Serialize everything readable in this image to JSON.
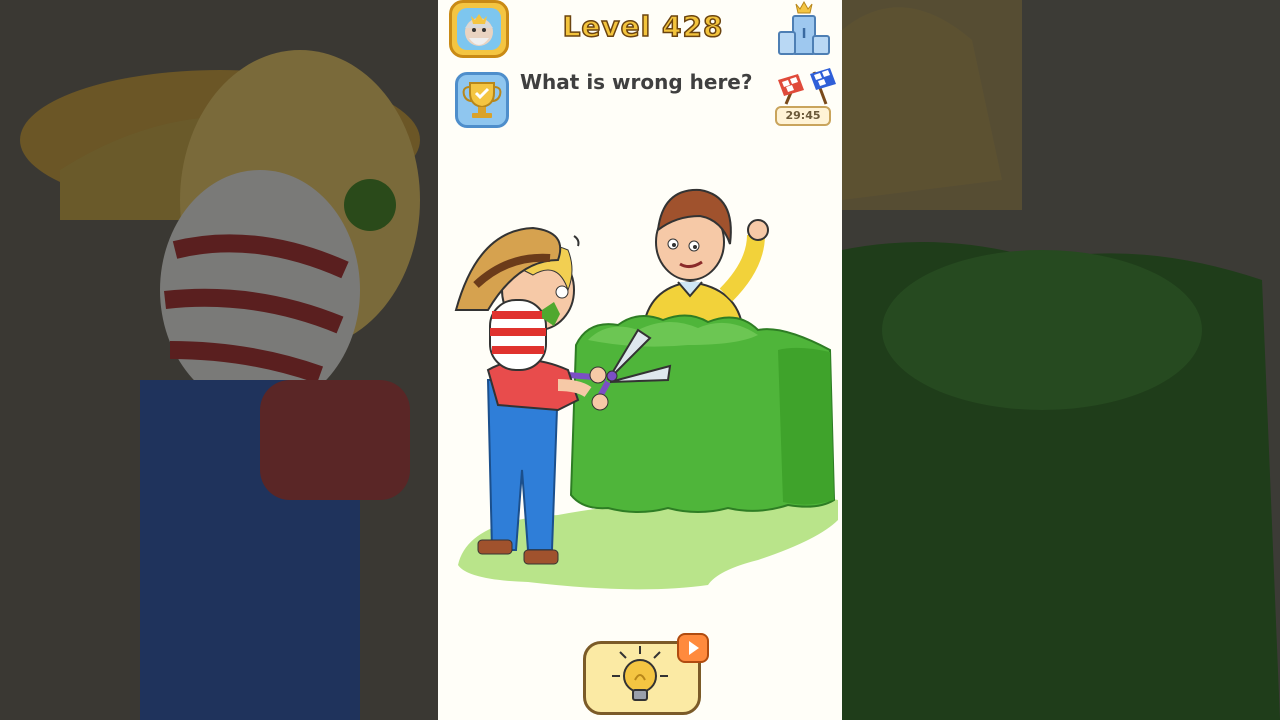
{
  "hud": {
    "level_title": "Level 428",
    "question": "What is wrong here?",
    "timer": "29:45"
  },
  "icons": {
    "avatar": "old-man-avatar-icon",
    "trophy": "trophy-icon",
    "rank": "podium-crown-icon",
    "race": "checkered-flags-icon",
    "hint": "lightbulb-hint-icon",
    "video": "play-video-icon"
  },
  "colors": {
    "title_fill": "#f3c43d",
    "hedge": "#4fb53a",
    "grass": "#b9e48a",
    "overalls": "#2f7ed8"
  }
}
